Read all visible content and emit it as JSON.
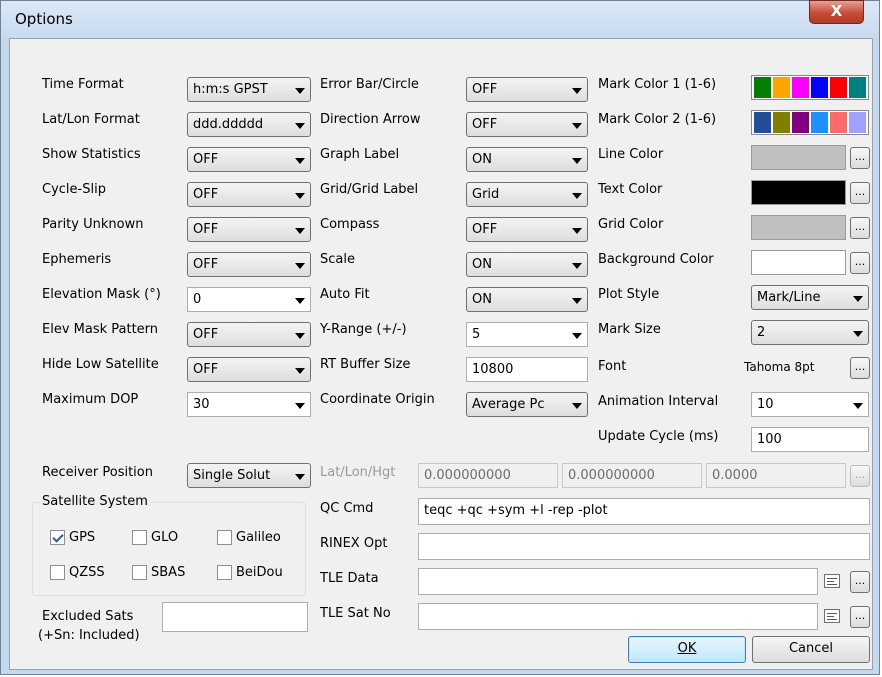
{
  "window": {
    "title": "Options",
    "close_glyph": "X"
  },
  "col1": {
    "time_format": {
      "label": "Time Format",
      "value": "h:m:s GPST"
    },
    "latlon_format": {
      "label": "Lat/Lon Format",
      "value": "ddd.ddddd"
    },
    "show_statistics": {
      "label": "Show Statistics",
      "value": "OFF"
    },
    "cycle_slip": {
      "label": "Cycle-Slip",
      "value": "OFF"
    },
    "parity_unknown": {
      "label": "Parity Unknown",
      "value": "OFF"
    },
    "ephemeris": {
      "label": "Ephemeris",
      "value": "OFF"
    },
    "elevation_mask": {
      "label": "Elevation Mask (°)",
      "value": "0"
    },
    "elev_mask_pattern": {
      "label": "Elev Mask Pattern",
      "value": "OFF"
    },
    "hide_low_satellite": {
      "label": "Hide Low Satellite",
      "value": "OFF"
    },
    "maximum_dop": {
      "label": "Maximum DOP",
      "value": "30"
    }
  },
  "col2": {
    "error_bar": {
      "label": "Error Bar/Circle",
      "value": "OFF"
    },
    "direction_arrow": {
      "label": "Direction Arrow",
      "value": "OFF"
    },
    "graph_label": {
      "label": "Graph Label",
      "value": "ON"
    },
    "grid_label": {
      "label": "Grid/Grid Label",
      "value": "Grid"
    },
    "compass": {
      "label": "Compass",
      "value": "OFF"
    },
    "scale": {
      "label": "Scale",
      "value": "ON"
    },
    "auto_fit": {
      "label": "Auto Fit",
      "value": "ON"
    },
    "y_range": {
      "label": "Y-Range (+/-)",
      "value": "5"
    },
    "rt_buffer": {
      "label": "RT Buffer Size",
      "value": "10800"
    },
    "coord_origin": {
      "label": "Coordinate Origin",
      "value": "Average Pc"
    }
  },
  "col3": {
    "mark_color1": {
      "label": "Mark Color 1 (1-6)",
      "colors": [
        "#008000",
        "#ffa500",
        "#ff00ff",
        "#0000ff",
        "#ff0000",
        "#008080"
      ]
    },
    "mark_color2": {
      "label": "Mark Color 2 (1-6)",
      "colors": [
        "#1f4e9a",
        "#808000",
        "#800080",
        "#1e90ff",
        "#ff6b6b",
        "#a0a0ff"
      ]
    },
    "line_color": {
      "label": "Line Color",
      "color": "#c0c0c0"
    },
    "text_color": {
      "label": "Text Color",
      "color": "#000000"
    },
    "grid_color": {
      "label": "Grid Color",
      "color": "#c0c0c0"
    },
    "background_color": {
      "label": "Background Color",
      "color": "#ffffff"
    },
    "plot_style": {
      "label": "Plot Style",
      "value": "Mark/Line"
    },
    "mark_size": {
      "label": "Mark Size",
      "value": "2"
    },
    "font": {
      "label": "Font",
      "value": "Tahoma 8pt"
    },
    "animation_interval": {
      "label": "Animation Interval",
      "value": "10"
    },
    "update_cycle": {
      "label": "Update Cycle (ms)",
      "value": "100"
    }
  },
  "receiver": {
    "label": "Receiver Position",
    "value": "Single Solut",
    "llh_label": "Lat/Lon/Hgt",
    "lat": "0.000000000",
    "lon": "0.000000000",
    "hgt": "0.0000"
  },
  "satsys": {
    "title": "Satellite System",
    "items": [
      {
        "label": "GPS",
        "checked": true
      },
      {
        "label": "GLO",
        "checked": false
      },
      {
        "label": "Galileo",
        "checked": false
      },
      {
        "label": "QZSS",
        "checked": false
      },
      {
        "label": "SBAS",
        "checked": false
      },
      {
        "label": "BeiDou",
        "checked": false
      }
    ]
  },
  "excluded": {
    "label1": "Excluded Sats",
    "label2": "(+Sn: Included)",
    "value": ""
  },
  "qc_cmd": {
    "label": "QC Cmd",
    "value": "teqc +qc +sym +l -rep -plot"
  },
  "rinex_opt": {
    "label": "RINEX Opt",
    "value": ""
  },
  "tle_data": {
    "label": "TLE Data",
    "value": ""
  },
  "tle_satno": {
    "label": "TLE Sat No",
    "value": ""
  },
  "buttons": {
    "ok": "OK",
    "cancel": "Cancel",
    "ellipsis": "..."
  }
}
